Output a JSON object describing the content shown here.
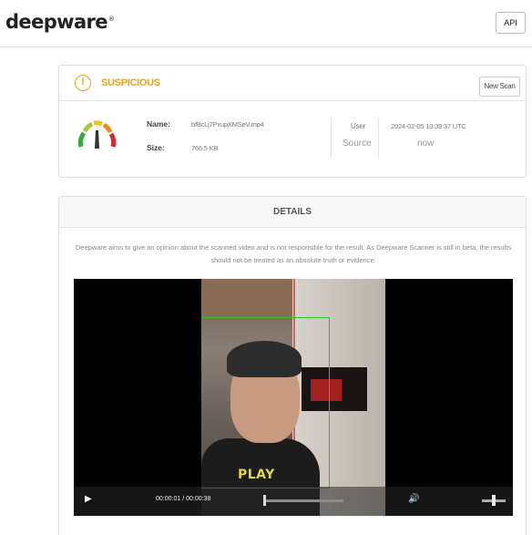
{
  "header": {
    "logo_text": "deepware",
    "logo_mark": "®",
    "api_label": "API"
  },
  "result": {
    "verdict": "SUSPICIOUS",
    "verdict_color": "#e8a317",
    "new_scan_label": "New Scan",
    "name_label": "Name:",
    "name_value": "bfBcLj7PxupXMSeV.mp4",
    "size_label": "Size:",
    "size_value": "766.5 KB",
    "user_label": "User",
    "source_label": "Source",
    "date_value": "2024-02-05 10:39:37 UTC",
    "relative_time": "now",
    "gauge_icon": "risk-gauge-icon"
  },
  "details": {
    "title": "DETAILS",
    "disclaimer": "Deepware aims to give an opinion about the scanned video and is not responsible for the result. As Deepware Scanner is still in beta, the results should not be treated as an absolute truth or evidence."
  },
  "video": {
    "shirt_text": "PLAY",
    "time_display": "00:00:01 / 00:00:38",
    "play_icon": "play-icon",
    "volume_icon": "volume-icon",
    "seek_progress": 0.03,
    "face_box_color": "#2ec42e"
  }
}
